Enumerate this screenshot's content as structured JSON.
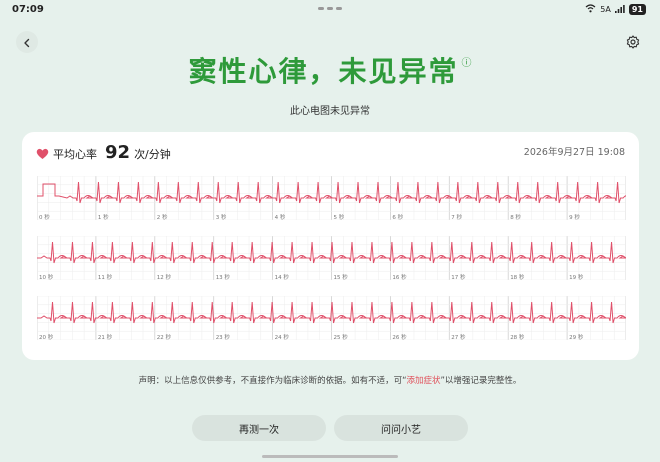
{
  "status_bar": {
    "time": "07:09",
    "signal_text": "5A",
    "battery": "91"
  },
  "header": {
    "back_icon": "chevron-left-icon",
    "settings_icon": "gear-icon",
    "title": "窦性心律，未见异常",
    "info_icon": "ⓘ",
    "subtitle": "此心电图未见异常"
  },
  "card": {
    "hr_label": "平均心率",
    "hr_value": "92",
    "hr_unit": "次/分钟",
    "datetime": "2026年9月27日 19:08",
    "seconds_labels": [
      [
        "0 秒",
        "1 秒",
        "2 秒",
        "3 秒",
        "4 秒",
        "5 秒",
        "6 秒",
        "7 秒",
        "8 秒",
        "9 秒"
      ],
      [
        "10 秒",
        "11 秒",
        "12 秒",
        "13 秒",
        "14 秒",
        "15 秒",
        "16 秒",
        "17 秒",
        "18 秒",
        "19 秒"
      ],
      [
        "20 秒",
        "21 秒",
        "22 秒",
        "23 秒",
        "24 秒",
        "25 秒",
        "26 秒",
        "27 秒",
        "28 秒",
        "29 秒"
      ]
    ]
  },
  "disclaimer": {
    "prefix": "声明：以上信息仅供参考，不直接作为临床诊断的依据。如有不适，可“",
    "link": "添加症状",
    "suffix": "”以增强记录完整性。"
  },
  "buttons": {
    "retest": "再测一次",
    "ask": "问问小艺"
  },
  "colors": {
    "accent_green": "#2e9a3a",
    "ecg_line": "#e0506a",
    "link_red": "#e0505a",
    "background": "#e6f1ec"
  }
}
